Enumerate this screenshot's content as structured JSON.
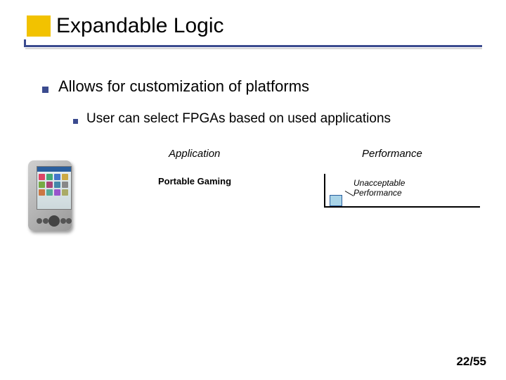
{
  "title": "Expandable Logic",
  "bullets": {
    "l1": "Allows for customization of platforms",
    "l2": "User can select FPGAs based on used applications"
  },
  "columns": {
    "application": "Application",
    "performance": "Performance"
  },
  "row": {
    "app_label": "Portable Gaming",
    "perf_label": "Unacceptable\nPerformance"
  },
  "page": "22/55",
  "chart_data": {
    "type": "bar",
    "title": "Performance",
    "categories": [
      "Portable Gaming"
    ],
    "values": [
      16
    ],
    "ylim": [
      0,
      48
    ],
    "annotation": "Unacceptable Performance"
  }
}
